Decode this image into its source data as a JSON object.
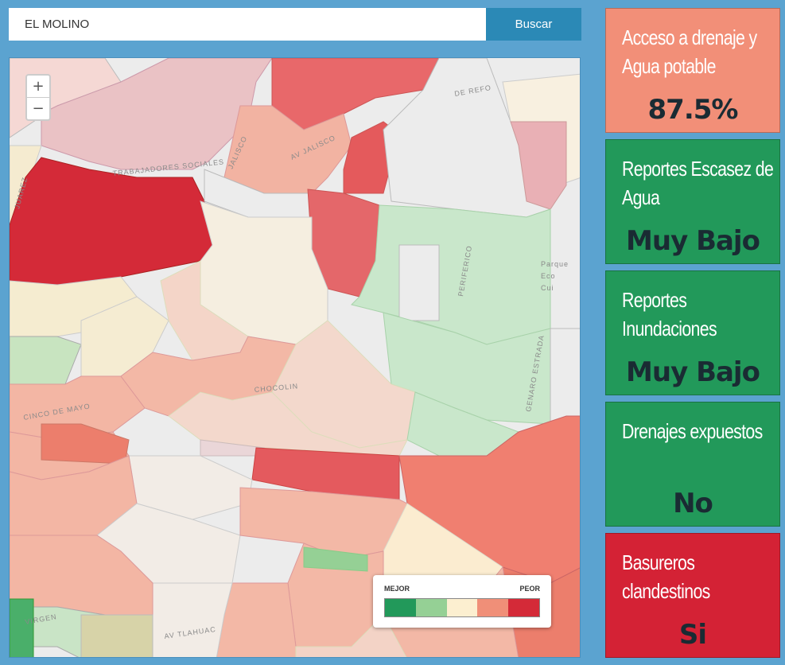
{
  "search": {
    "value": "EL MOLINO",
    "button_label": "Buscar"
  },
  "map": {
    "zoom_in": "+",
    "zoom_out": "−",
    "street_labels": [
      "TRABAJADORES SOCIALES",
      "AV JALISCO",
      "JALISCO",
      "PERIFERICO",
      "CHOCOLIN",
      "CINCO DE MAYO",
      "GENARO ESTRADA",
      "AV TLAHUAC",
      "DE REFO",
      "JUAREZ",
      "VIRGEN",
      "Parque",
      "Eco",
      "Cui"
    ],
    "legend": {
      "low_label": "MEJOR",
      "high_label": "PEOR",
      "colors": [
        "#22995a",
        "#95d095",
        "#fcefd0",
        "#f08f78",
        "#d42a38"
      ]
    }
  },
  "cards": [
    {
      "title": "Acceso a drenaje y Agua potable",
      "value": "87.5%",
      "color": "#f28f78"
    },
    {
      "title": "Reportes Escasez de Agua",
      "value": "Muy Bajo",
      "color": "#22995a"
    },
    {
      "title": "Reportes Inundaciones",
      "value": "Muy Bajo",
      "color": "#22995a"
    },
    {
      "title": "Drenajes expuestos",
      "value": "No",
      "color": "#22995a"
    },
    {
      "title": "Basureros clandestinos",
      "value": "Si",
      "color": "#d42235"
    }
  ]
}
